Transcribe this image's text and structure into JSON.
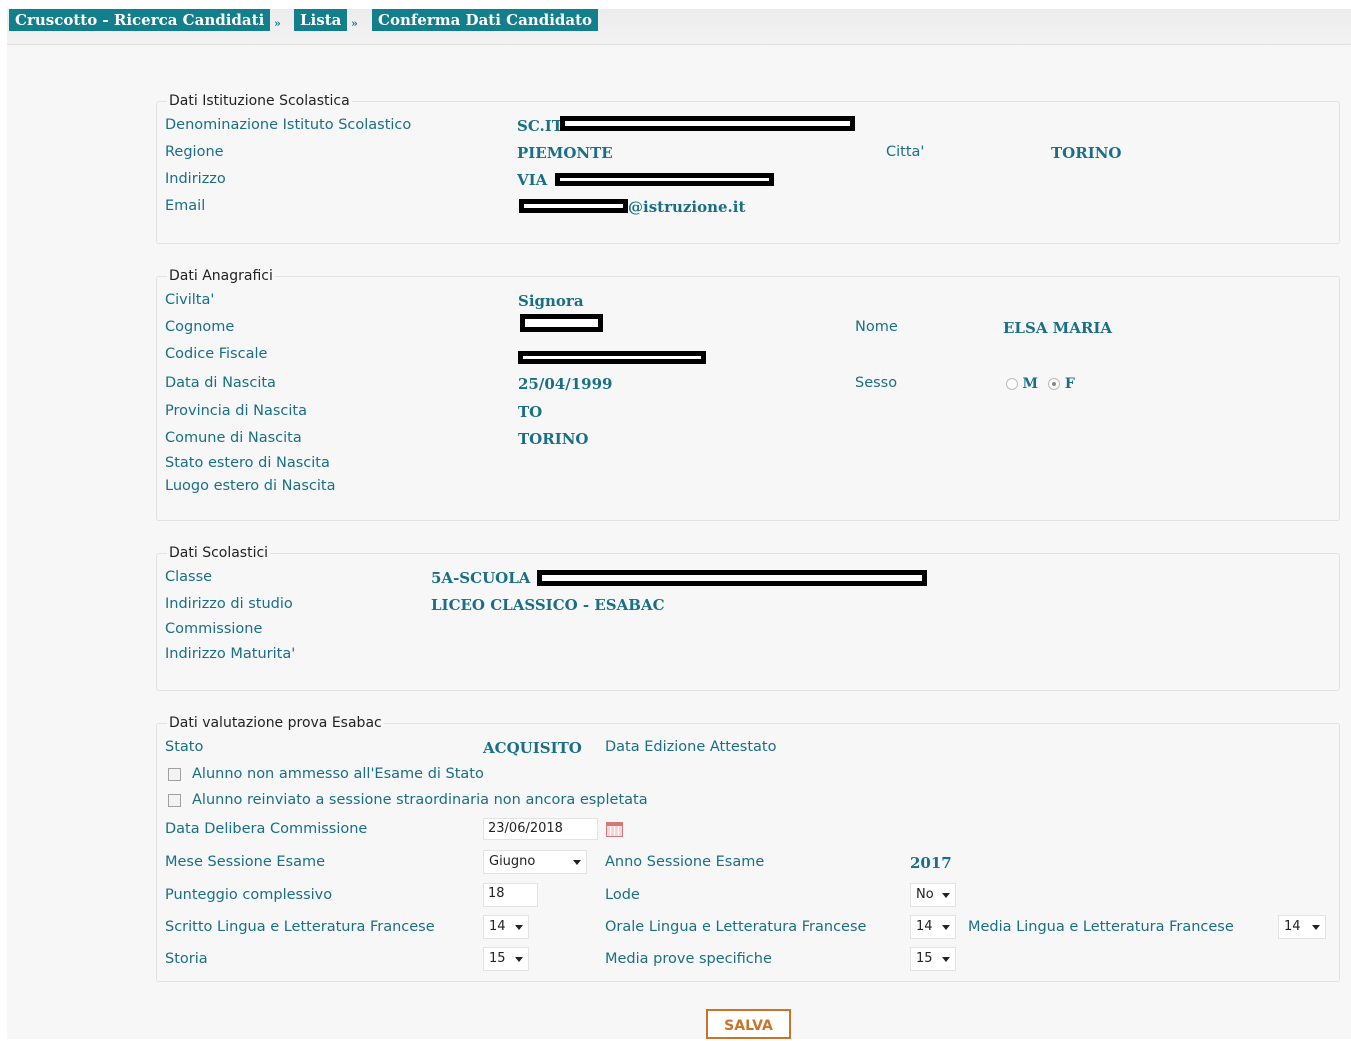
{
  "breadcrumb": {
    "items": [
      "Cruscotto - Ricerca Candidati",
      "Lista",
      "Conferma Dati Candidato"
    ],
    "separator": "»"
  },
  "istituzione": {
    "legend": "Dati Istituzione Scolastica",
    "denominazione_label": "Denominazione Istituto Scolastico",
    "denominazione_value": "SC.IT",
    "regione_label": "Regione",
    "regione_value": "PIEMONTE",
    "citta_label": "Citta'",
    "citta_value": "TORINO",
    "indirizzo_label": "Indirizzo",
    "indirizzo_value": "VIA",
    "email_label": "Email",
    "email_value": "@istruzione.it"
  },
  "anagrafici": {
    "legend": "Dati Anagrafici",
    "civilta_label": "Civilta'",
    "civilta_value": "Signora",
    "cognome_label": "Cognome",
    "nome_label": "Nome",
    "nome_value": "ELSA MARIA",
    "codice_fiscale_label": "Codice Fiscale",
    "data_nascita_label": "Data di Nascita",
    "data_nascita_value": "25/04/1999",
    "sesso_label": "Sesso",
    "sesso_m": "M",
    "sesso_f": "F",
    "sesso_selected": "F",
    "provincia_label": "Provincia di Nascita",
    "provincia_value": "TO",
    "comune_label": "Comune di Nascita",
    "comune_value": "TORINO",
    "stato_estero_label": "Stato estero di Nascita",
    "luogo_estero_label": "Luogo estero di Nascita"
  },
  "scolastici": {
    "legend": "Dati Scolastici",
    "classe_label": "Classe",
    "classe_value": "5A-SCUOLA",
    "indirizzo_studio_label": "Indirizzo di studio",
    "indirizzo_studio_value": "LICEO CLASSICO - ESABAC",
    "commissione_label": "Commissione",
    "indirizzo_maturita_label": "Indirizzo Maturita'"
  },
  "esabac": {
    "legend": "Dati valutazione prova Esabac",
    "stato_label": "Stato",
    "stato_value": "ACQUISITO",
    "data_edizione_label": "Data Edizione Attestato",
    "non_ammesso_label": "Alunno non ammesso all'Esame di Stato",
    "reinviato_label": "Alunno reinviato a sessione straordinaria non ancora espletata",
    "data_delibera_label": "Data Delibera Commissione",
    "data_delibera_value": "23/06/2018",
    "mese_sessione_label": "Mese Sessione Esame",
    "mese_sessione_value": "Giugno",
    "anno_sessione_label": "Anno Sessione Esame",
    "anno_sessione_value": "2017",
    "punteggio_label": "Punteggio complessivo",
    "punteggio_value": "18",
    "lode_label": "Lode",
    "lode_value": "No",
    "scritto_label": "Scritto Lingua e Letteratura Francese",
    "scritto_value": "14",
    "orale_label": "Orale Lingua e Letteratura Francese",
    "orale_value": "14",
    "media_lingua_label": "Media Lingua e Letteratura Francese",
    "media_lingua_value": "14",
    "storia_label": "Storia",
    "storia_value": "15",
    "media_prove_label": "Media prove specifiche",
    "media_prove_value": "15"
  },
  "actions": {
    "save_label": "SALVA"
  },
  "colors": {
    "accent": "#137e8c",
    "text": "#1a6f86",
    "save_border": "#c9742a"
  }
}
